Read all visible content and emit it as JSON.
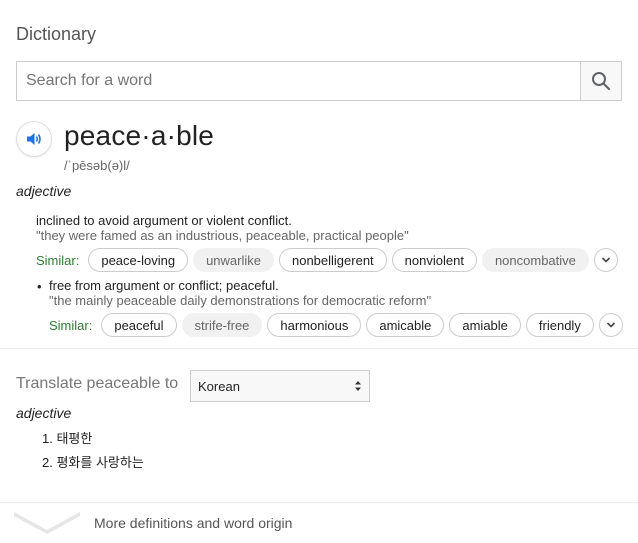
{
  "header": {
    "title": "Dictionary"
  },
  "search": {
    "placeholder": "Search for a word",
    "value": ""
  },
  "entry": {
    "word": "peace·a·ble",
    "phonetic": "/ˈpēsəb(ə)l/",
    "part_of_speech": "adjective",
    "senses": [
      {
        "definition": "inclined to avoid argument or violent conflict.",
        "example": "\"they were famed as an industrious, peaceable, practical people\"",
        "similar_label": "Similar:",
        "similar": [
          "peace-loving",
          "unwarlike",
          "nonbelligerent",
          "nonviolent",
          "noncombative"
        ]
      },
      {
        "bullet": "•",
        "definition": "free from argument or conflict; peaceful.",
        "example": "\"the mainly peaceable daily demonstrations for democratic reform\"",
        "similar_label": "Similar:",
        "similar": [
          "peaceful",
          "strife-free",
          "harmonious",
          "amicable",
          "amiable",
          "friendly"
        ]
      }
    ]
  },
  "translate": {
    "label": "Translate peaceable to",
    "language": "Korean",
    "part_of_speech": "adjective",
    "items": [
      "1. 태평한",
      "2. 평화를 사랑하는"
    ]
  },
  "footer": {
    "more_label": "More definitions and word origin"
  },
  "colors": {
    "accent_blue": "#1a73e8",
    "similar_green": "#2e7d32"
  }
}
